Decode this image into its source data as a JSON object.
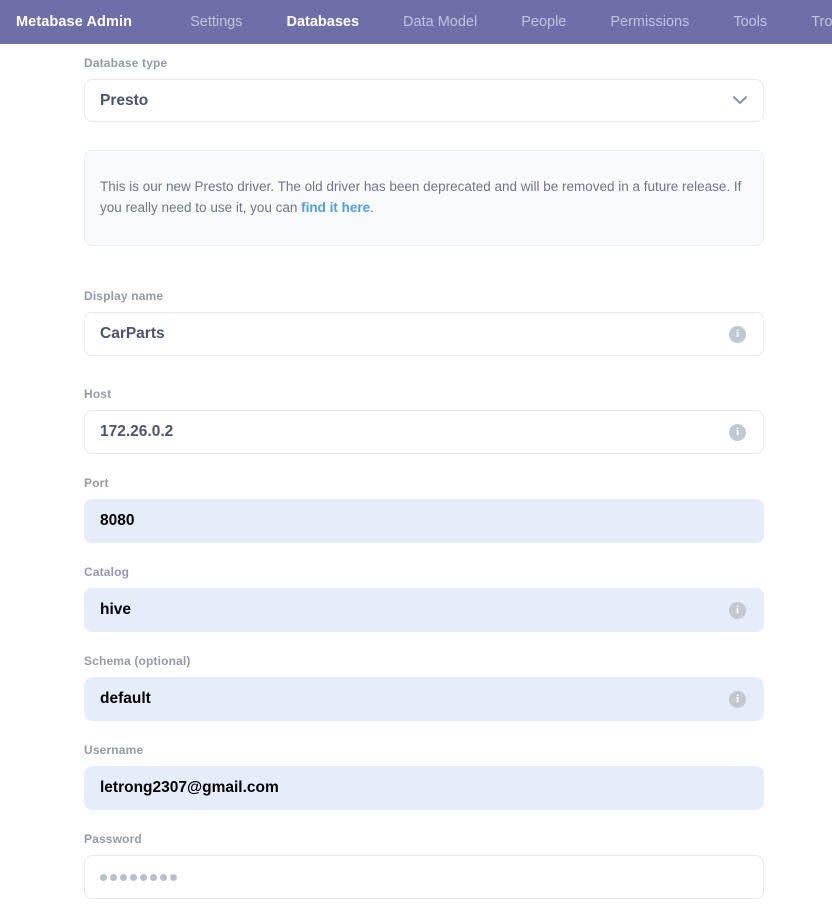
{
  "navbar": {
    "brand": "Metabase Admin",
    "items": [
      {
        "label": "Settings",
        "active": false
      },
      {
        "label": "Databases",
        "active": true
      },
      {
        "label": "Data Model",
        "active": false
      },
      {
        "label": "People",
        "active": false
      },
      {
        "label": "Permissions",
        "active": false
      },
      {
        "label": "Tools",
        "active": false
      },
      {
        "label": "Troubleshooting",
        "active": false
      }
    ],
    "background_color": "#6E6FA8",
    "active_color": "#FFFFFF"
  },
  "form": {
    "database_type": {
      "label": "Database type",
      "value": "Presto",
      "icon": "chevron-down-icon"
    },
    "driver_notice": {
      "text_before": "This is our new Presto driver. The old driver has been deprecated and will be removed in a future release. If you really need to use it, you can ",
      "link_text": "find it here",
      "text_after": ".",
      "link_color": "#509EE3"
    },
    "display_name": {
      "label": "Display name",
      "value": "CarParts",
      "has_info_icon": true,
      "autofilled": false
    },
    "host": {
      "label": "Host",
      "value": "172.26.0.2",
      "has_info_icon": true,
      "autofilled": false
    },
    "port": {
      "label": "Port",
      "value": "8080",
      "has_info_icon": false,
      "autofilled": true
    },
    "catalog": {
      "label": "Catalog",
      "value": "hive",
      "has_info_icon": true,
      "autofilled": true
    },
    "schema": {
      "label": "Schema (optional)",
      "value": "default",
      "has_info_icon": true,
      "autofilled": true
    },
    "username": {
      "label": "Username",
      "value": "letrong2307@gmail.com",
      "has_info_icon": false,
      "autofilled": true
    },
    "password": {
      "label": "Password",
      "masked_char_count": 8,
      "has_info_icon": false,
      "autofilled": false
    }
  }
}
